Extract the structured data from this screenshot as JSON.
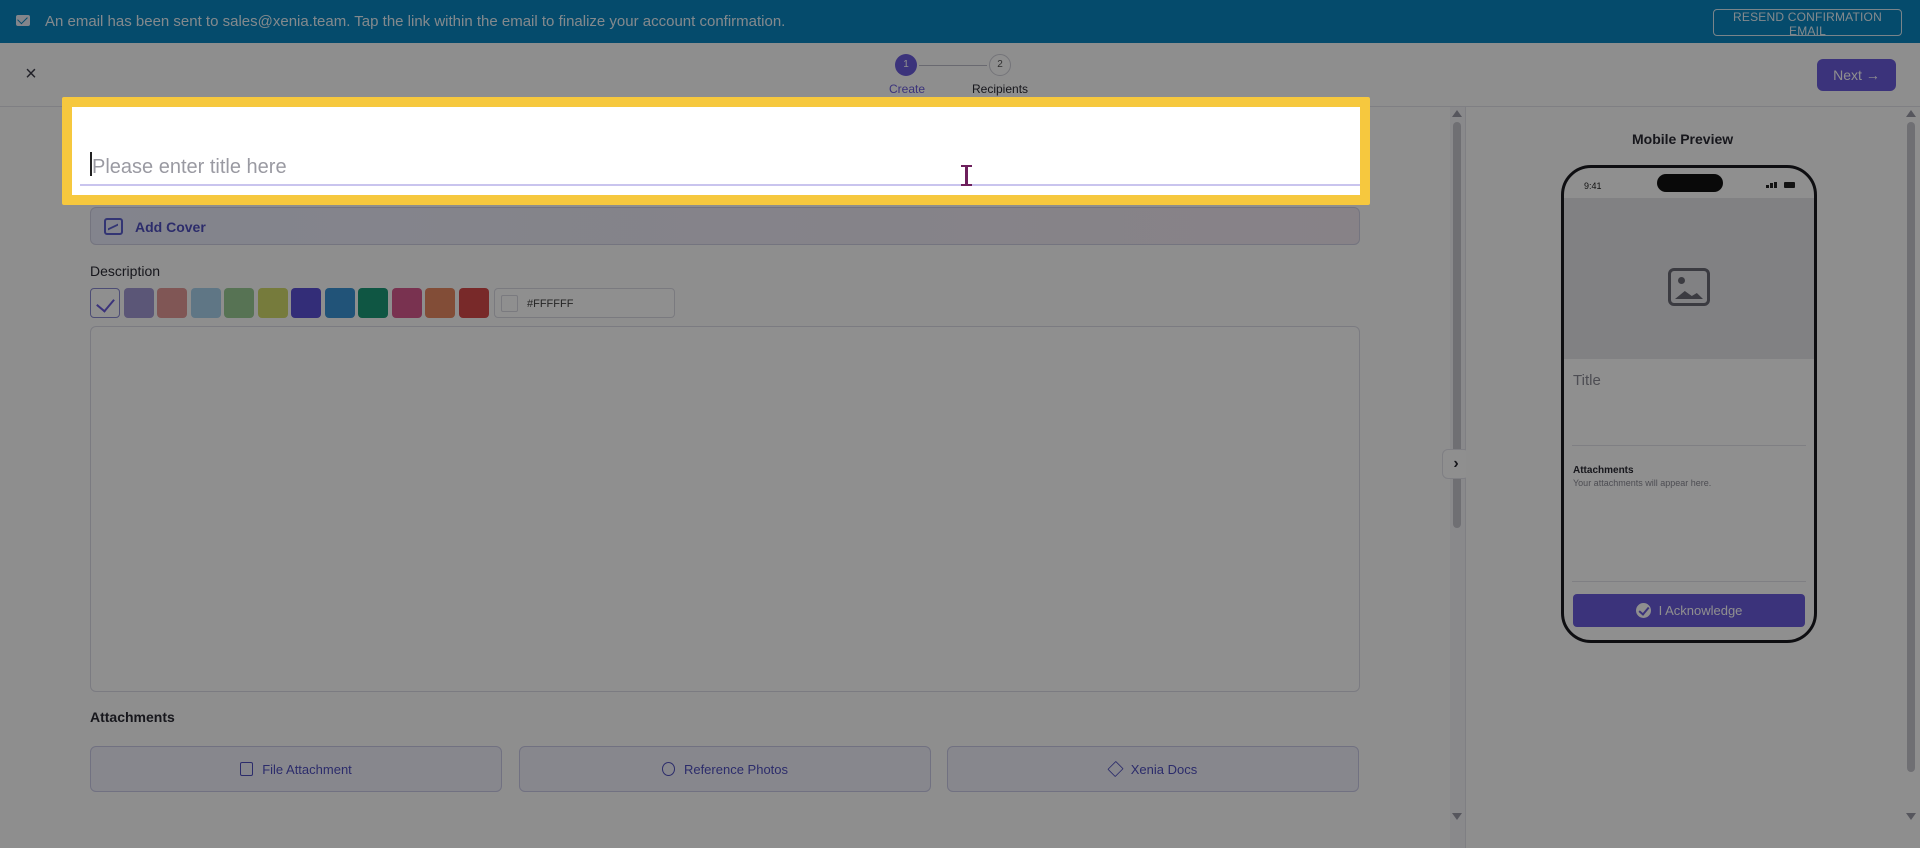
{
  "banner": {
    "message": "An email has been sent to sales@xenia.team. Tap the link within the email to finalize your account confirmation.",
    "resend_label": "RESEND CONFIRMATION EMAIL",
    "icon": "mail-icon",
    "color": "#0a86c0"
  },
  "header": {
    "close_icon": "×",
    "steps": [
      {
        "number": "1",
        "label": "Create",
        "active": true
      },
      {
        "number": "2",
        "label": "Recipients",
        "active": false
      }
    ],
    "next_label": "Next →",
    "accent": "#6a5bdb"
  },
  "form": {
    "title_placeholder": "Please enter title here",
    "cover_label": "Add Cover",
    "description_label": "Description",
    "swatch_colors": [
      "#ffffff",
      "#a39ad4",
      "#e59a98",
      "#a9d3ee",
      "#9ccd97",
      "#d2dc6c",
      "#5b50d6",
      "#3b95d6",
      "#1b9a78",
      "#d85a8f",
      "#e88a62",
      "#d64a4a"
    ],
    "hex_value": "#FFFFFF",
    "attachments_label": "Attachments",
    "attachment_buttons": [
      {
        "label": "File Attachment",
        "icon": "file-icon"
      },
      {
        "label": "Reference Photos",
        "icon": "photo-icon"
      },
      {
        "label": "Xenia Docs",
        "icon": "stack-icon"
      }
    ]
  },
  "preview": {
    "title": "Mobile Preview",
    "time": "9:41",
    "card_title": "Title",
    "attachments_heading": "Attachments",
    "attachments_empty": "Your attachments will appear here.",
    "ack_label": "I Acknowledge"
  },
  "highlight_color": "#f6c83e"
}
